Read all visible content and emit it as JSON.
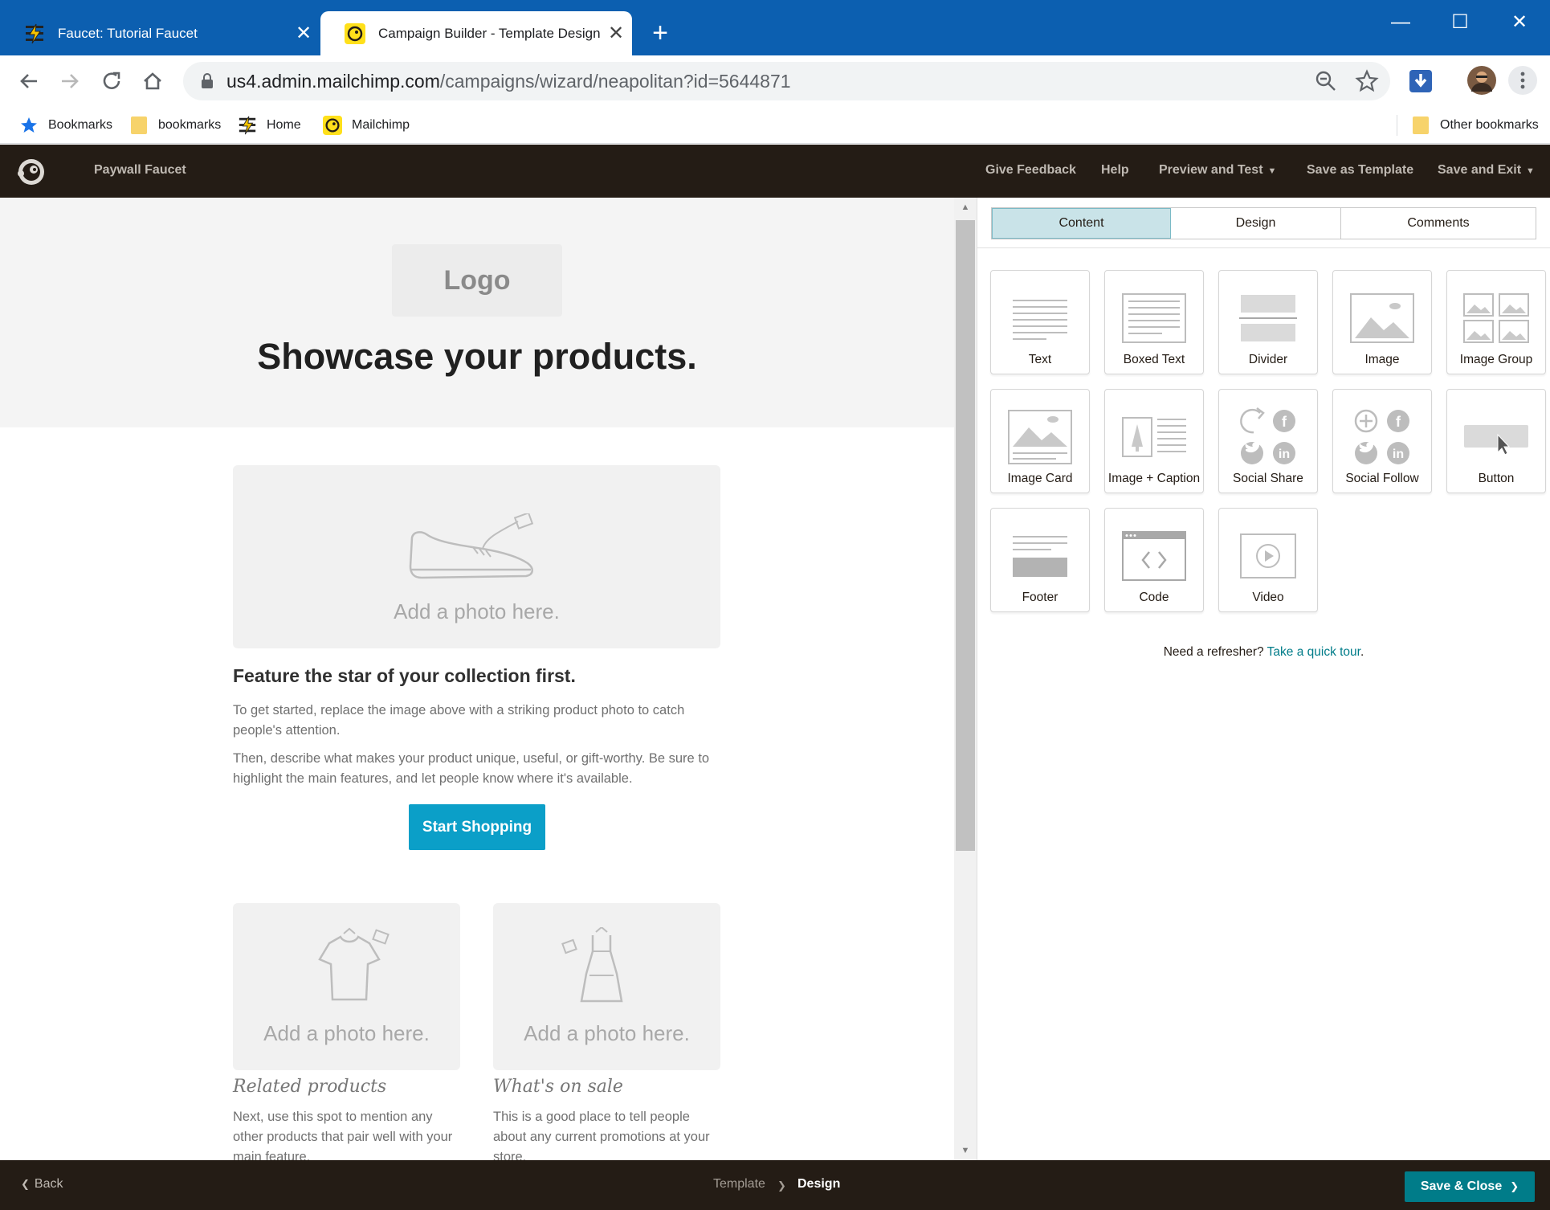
{
  "browser": {
    "tabs": [
      {
        "title": "Faucet: Tutorial Faucet",
        "active": false
      },
      {
        "title": "Campaign Builder - Template Designer | Mai",
        "active": true
      }
    ],
    "url_host": "us4.admin.mailchimp.com",
    "url_path": "/campaigns/wizard/neapolitan?id=5644871",
    "bookmarks": [
      "Bookmarks",
      "bookmarks",
      "Home",
      "Mailchimp"
    ],
    "other_bookmarks": "Other bookmarks"
  },
  "header": {
    "campaign_name": "Paywall Faucet",
    "nav": {
      "feedback": "Give Feedback",
      "help": "Help",
      "preview": "Preview and Test",
      "save_template": "Save as Template",
      "save_exit": "Save and Exit"
    }
  },
  "email": {
    "logo": "Logo",
    "headline": "Showcase your products.",
    "main_photo_caption": "Add a photo here.",
    "feature_title": "Feature the star of your collection first.",
    "feature_para_1": "To get started, replace the image above with a striking product photo to catch people's attention.",
    "feature_para_2": "Then, describe what makes your product unique, useful, or gift-worthy. Be sure to highlight the main features, and let people know where it's available.",
    "cta": "Start Shopping",
    "col_left": {
      "photo_caption": "Add a photo here.",
      "title": "Related products",
      "text": "Next, use this spot to mention any other products that pair well with your main feature."
    },
    "col_right": {
      "photo_caption": "Add a photo here.",
      "title": "What's on sale",
      "text": "This is a good place to tell people about any current promotions at your store."
    }
  },
  "panel": {
    "tabs": [
      "Content",
      "Design",
      "Comments"
    ],
    "active_tab": "Content",
    "blocks": [
      {
        "label": "Text",
        "icon": "text-block-icon"
      },
      {
        "label": "Boxed Text",
        "icon": "boxed-text-block-icon"
      },
      {
        "label": "Divider",
        "icon": "divider-block-icon"
      },
      {
        "label": "Image",
        "icon": "image-block-icon"
      },
      {
        "label": "Image Group",
        "icon": "image-group-block-icon"
      },
      {
        "label": "Image Card",
        "icon": "image-card-block-icon"
      },
      {
        "label": "Image + Caption",
        "icon": "image-caption-block-icon"
      },
      {
        "label": "Social Share",
        "icon": "social-share-block-icon"
      },
      {
        "label": "Social Follow",
        "icon": "social-follow-block-icon"
      },
      {
        "label": "Button",
        "icon": "button-block-icon"
      },
      {
        "label": "Footer",
        "icon": "footer-block-icon"
      },
      {
        "label": "Code",
        "icon": "code-block-icon"
      },
      {
        "label": "Video",
        "icon": "video-block-icon"
      }
    ],
    "refresher_text": "Need a refresher?",
    "refresher_link": "Take a quick tour",
    "refresher_end": "."
  },
  "footer": {
    "back": "Back",
    "crumb_template": "Template",
    "crumb_design": "Design",
    "save_close": "Save & Close"
  },
  "colors": {
    "chrome_blue": "#0c5fb0",
    "mc_dark": "#241c15",
    "cta_blue": "#0b9fc8",
    "teal": "#007c89",
    "active_tab": "#c9e3e8"
  }
}
